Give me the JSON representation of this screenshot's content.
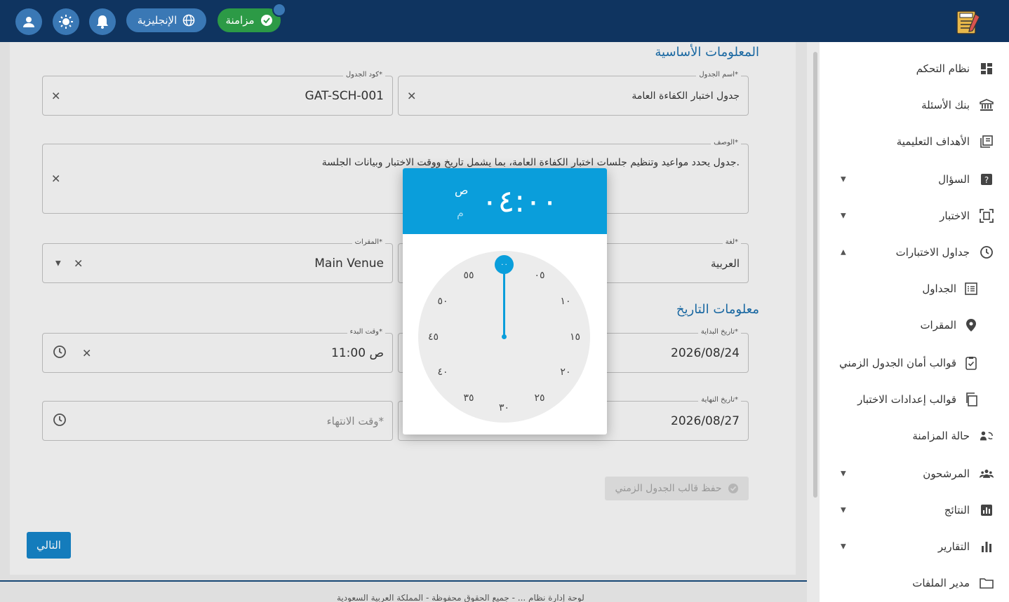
{
  "topbar": {
    "language_label": "الإنجليزية",
    "sync_label": "مزامنة"
  },
  "sections": {
    "basic_info": "المعلومات الأساسية",
    "date_info": "معلومات التاريخ"
  },
  "form": {
    "schedule_name": {
      "label": "اسم الجدول*",
      "value": "جدول اختبار الكفاءة العامة"
    },
    "schedule_code": {
      "label": "كود الجدول*",
      "value": "GAT-SCH-001"
    },
    "description": {
      "label": "الوصف*",
      "value": "جدول يحدد مواعيد وتنظيم جلسات اختبار الكفاءة العامة، بما يشمل تاريخ ووقت الاختبار وبيانات الجلسة."
    },
    "language": {
      "label": "لغة*",
      "value": "العربية"
    },
    "venues": {
      "label": "المقرات*",
      "value": "Main Venue"
    },
    "start_date": {
      "label": "تاريخ البداية*",
      "value": "2026/08/24"
    },
    "start_time": {
      "label": "وقت البدء*",
      "value": "11:00 ص"
    },
    "end_date": {
      "label": "تاريخ النهاية*",
      "value": "2026/08/27"
    },
    "end_time": {
      "placeholder": "وقت الانتهاء*"
    },
    "save_template_label": "حفظ قالب الجدول الزمني",
    "next_label": "التالي"
  },
  "time_picker": {
    "time": "٠٤:٠٠",
    "am": "ص",
    "pm": "م",
    "selected_minute": "٠٠",
    "minutes": [
      "٠٥",
      "١٠",
      "١٥",
      "٢٠",
      "٢٥",
      "٣٠",
      "٣٥",
      "٤٠",
      "٤٥",
      "٥٠",
      "٥٥"
    ]
  },
  "sidebar": {
    "items": [
      {
        "label": "نظام التحكم",
        "icon": "dashboard-icon"
      },
      {
        "label": "بنك الأسئلة",
        "icon": "bank-icon"
      },
      {
        "label": "الأهداف التعليمية",
        "icon": "goals-icon"
      },
      {
        "label": "السؤال",
        "icon": "question-icon",
        "caret": "▼"
      },
      {
        "label": "الاختبار",
        "icon": "exam-icon",
        "caret": "▼"
      },
      {
        "label": "جداول الاختبارات",
        "icon": "clock-icon",
        "caret": "▲"
      },
      {
        "label": "الجداول",
        "icon": "list-icon",
        "sub": true
      },
      {
        "label": "المقرات",
        "icon": "location-icon",
        "sub": true
      },
      {
        "label": "قوالب أمان الجدول الزمني",
        "icon": "secure-icon",
        "sub": true
      },
      {
        "label": "قوالب إعدادات الاختبار",
        "icon": "copy-icon",
        "sub": true
      },
      {
        "label": "حالة المزامنة",
        "icon": "sync-status-icon"
      },
      {
        "label": "المرشحون",
        "icon": "people-icon",
        "caret": "▼"
      },
      {
        "label": "النتائج",
        "icon": "results-icon",
        "caret": "▼"
      },
      {
        "label": "التقارير",
        "icon": "reports-icon",
        "caret": "▼"
      },
      {
        "label": "مدير الملفات",
        "icon": "folder-icon"
      }
    ]
  },
  "footer": {
    "text": "لوحة إدارة نظام ... - جميع الحقوق محفوظة - المملكة العربية السعودية"
  },
  "colors": {
    "topbar": "#0f3460",
    "accent": "#0a9edb",
    "sync": "#2c9a46",
    "section_title": "#1a6ca8"
  }
}
